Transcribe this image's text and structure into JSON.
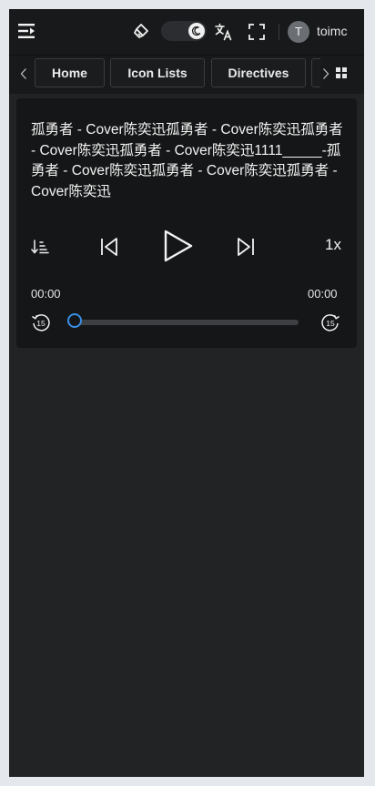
{
  "header": {
    "user_initial": "T",
    "username": "toimc",
    "icons": [
      "menu-fold-icon",
      "clear-cache-icon",
      "theme-toggle-moon-icon",
      "translate-icon",
      "fullscreen-icon"
    ]
  },
  "tabs": {
    "items": [
      {
        "label": "Home"
      },
      {
        "label": "Icon Lists"
      },
      {
        "label": "Directives"
      }
    ]
  },
  "player": {
    "title": "孤勇者 - Cover陈奕迅孤勇者 - Cover陈奕迅孤勇者 - Cover陈奕迅孤勇者 - Cover陈奕迅1111_____-孤勇者 - Cover陈奕迅孤勇者 - Cover陈奕迅孤勇者 - Cover陈奕迅",
    "speed": "1x",
    "current_time": "00:00",
    "duration": "00:00",
    "progress": 0,
    "skip_back_label": "15",
    "skip_forward_label": "15"
  },
  "colors": {
    "background": "#222324",
    "header": "#18191a",
    "card": "#151617",
    "accent": "#3a8ee6"
  }
}
